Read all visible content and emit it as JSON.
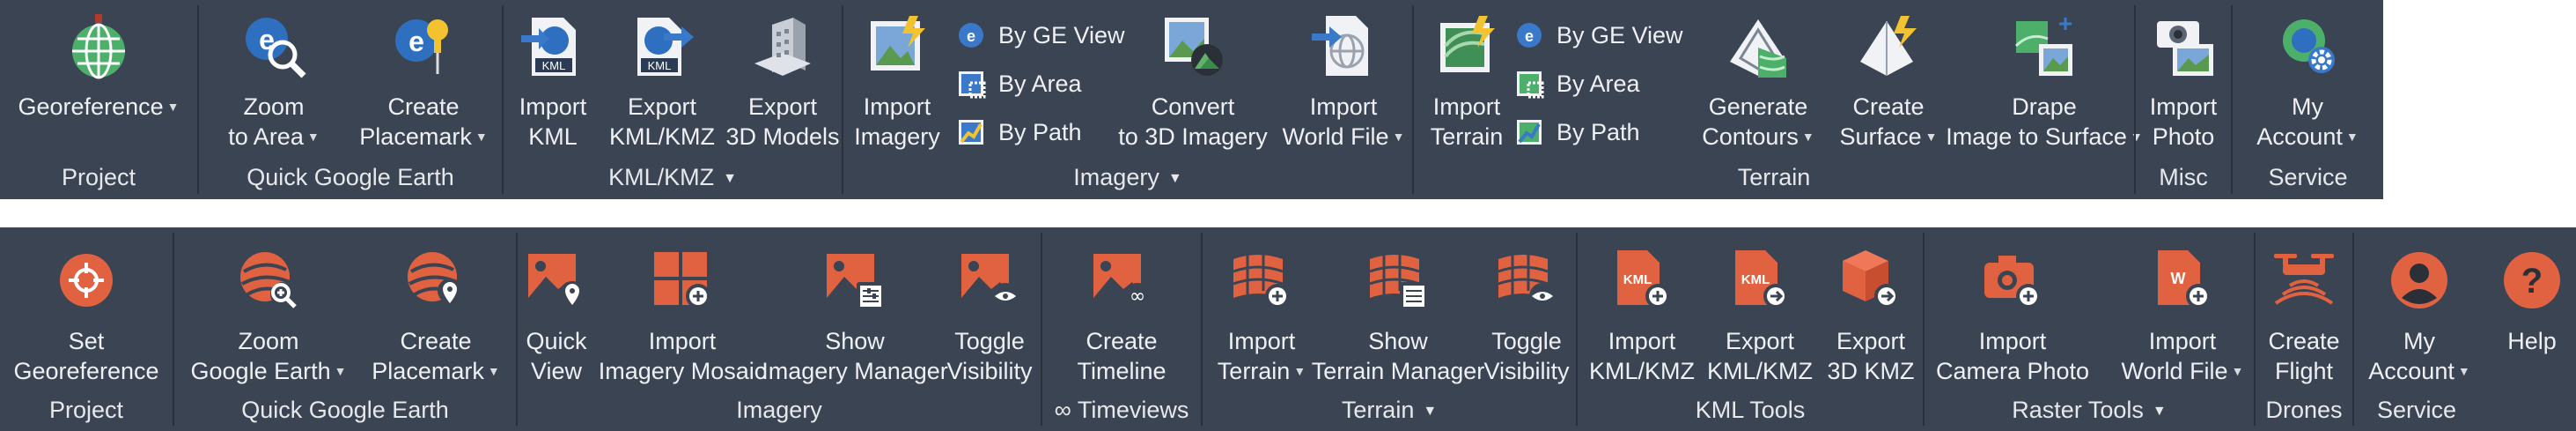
{
  "ribbon_top": {
    "groups": [
      {
        "name": "Project",
        "buttons": [
          {
            "label": "Georeference",
            "icon": "globe-grid-icon",
            "dropdown": true
          }
        ]
      },
      {
        "name": "Quick Google Earth",
        "buttons": [
          {
            "label": "Zoom to Area",
            "icon": "zoom-globe-icon",
            "dropdown": true
          },
          {
            "label": "Create Placemark",
            "icon": "pushpin-globe-icon",
            "dropdown": true
          }
        ]
      },
      {
        "name": "KML/KMZ",
        "dropdown": true,
        "buttons": [
          {
            "label": "Import KML",
            "icon": "kml-import-icon"
          },
          {
            "label": "Export KML/KMZ",
            "icon": "kml-export-icon"
          },
          {
            "label": "Export 3D Models",
            "icon": "building-3d-icon"
          }
        ]
      },
      {
        "name": "Imagery",
        "dropdown": true,
        "buttons": [
          {
            "label": "Import Imagery",
            "icon": "import-imagery-icon"
          },
          {
            "label": "Convert to 3D Imagery",
            "icon": "convert-3d-imagery-icon"
          },
          {
            "label": "Import World File",
            "icon": "world-file-icon",
            "dropdown": true
          }
        ],
        "small": [
          {
            "label": "By GE View",
            "icon": "ge-view-icon"
          },
          {
            "label": "By Area",
            "icon": "area-icon"
          },
          {
            "label": "By Path",
            "icon": "path-icon"
          }
        ]
      },
      {
        "name": "Terrain",
        "buttons": [
          {
            "label": "Import Terrain",
            "icon": "import-terrain-icon"
          },
          {
            "label": "Generate Contours",
            "icon": "contours-icon",
            "dropdown": true
          },
          {
            "label": "Create Surface",
            "icon": "surface-icon",
            "dropdown": true
          },
          {
            "label": "Drape Image to Surface",
            "icon": "drape-image-icon",
            "dropdown": true
          }
        ],
        "small": [
          {
            "label": "By GE View",
            "icon": "ge-view-icon"
          },
          {
            "label": "By Area",
            "icon": "area-icon"
          },
          {
            "label": "By Path",
            "icon": "path-icon"
          }
        ]
      },
      {
        "name": "Misc",
        "buttons": [
          {
            "label": "Import Photo",
            "icon": "camera-photo-icon"
          }
        ]
      },
      {
        "name": "Service",
        "buttons": [
          {
            "label": "My Account",
            "icon": "account-gear-icon",
            "dropdown": true
          }
        ]
      }
    ]
  },
  "ribbon_bottom": {
    "groups": [
      {
        "name": "Project",
        "buttons": [
          {
            "label": "Set Georeference",
            "icon": "target-icon"
          }
        ]
      },
      {
        "name": "Quick Google Earth",
        "buttons": [
          {
            "label": "Zoom Google Earth",
            "icon": "zoom-earth-icon",
            "dropdown": true
          },
          {
            "label": "Create Placemark",
            "icon": "placemark-earth-icon",
            "dropdown": true
          }
        ]
      },
      {
        "name": "Imagery",
        "buttons": [
          {
            "label": "Quick View",
            "icon": "image-pin-icon"
          },
          {
            "label": "Import Imagery Mosaic",
            "icon": "mosaic-icon"
          },
          {
            "label": "Show Imagery Manager",
            "icon": "imagery-manager-icon"
          },
          {
            "label": "Toggle Visibility",
            "icon": "image-eye-icon"
          }
        ]
      },
      {
        "name": "∞ Timeviews",
        "buttons": [
          {
            "label": "Create Timeline",
            "icon": "timeline-icon"
          }
        ]
      },
      {
        "name": "Terrain",
        "dropdown": true,
        "buttons": [
          {
            "label": "Import Terrain",
            "icon": "terrain-grid-plus-icon",
            "dropdown": true
          },
          {
            "label": "Show Terrain Manager",
            "icon": "terrain-manager-icon"
          },
          {
            "label": "Toggle Visibility",
            "icon": "terrain-eye-icon"
          }
        ]
      },
      {
        "name": "KML Tools",
        "buttons": [
          {
            "label": "Import KML/KMZ",
            "icon": "kml-plus-icon"
          },
          {
            "label": "Export KML/KMZ",
            "icon": "kml-arrow-icon"
          },
          {
            "label": "Export 3D KMZ",
            "icon": "cube-arrow-icon"
          }
        ]
      },
      {
        "name": "Raster Tools",
        "dropdown": true,
        "buttons": [
          {
            "label": "Import Camera Photo",
            "icon": "camera-plus-icon"
          },
          {
            "label": "Import World File",
            "icon": "world-file-plus-icon",
            "dropdown": true
          }
        ]
      },
      {
        "name": "Drones",
        "buttons": [
          {
            "label": "Create Flight",
            "icon": "drone-icon"
          }
        ]
      },
      {
        "name": "Service",
        "buttons": [
          {
            "label": "My Account",
            "icon": "user-icon",
            "dropdown": true
          },
          {
            "label": "Help",
            "icon": "help-icon"
          }
        ]
      }
    ]
  },
  "colors": {
    "ribbon_bg": "#3b4453",
    "separator": "#2b313c",
    "text": "#e6e8ec",
    "accent_orange": "#e06240",
    "accent_blue": "#3a78c9",
    "accent_green": "#5caa6e"
  }
}
